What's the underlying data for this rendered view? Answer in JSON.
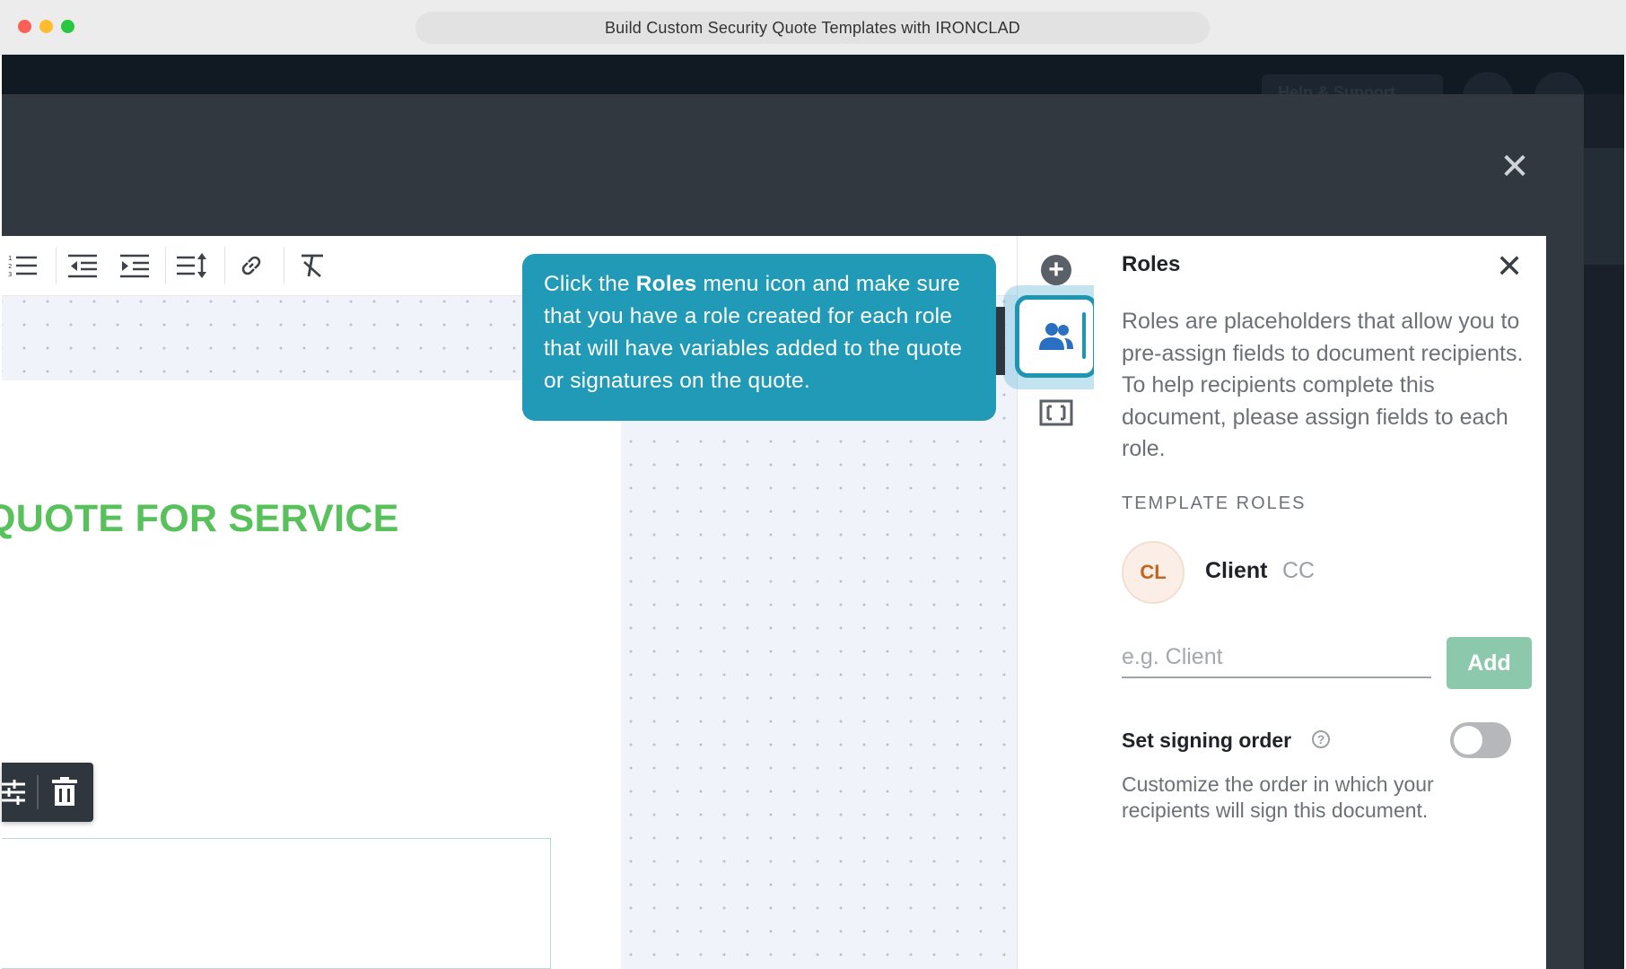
{
  "window": {
    "title": "Build Custom Security Quote Templates with IRONCLAD"
  },
  "app_header": {
    "help_button_label": "Help & Support"
  },
  "modal": {
    "close_icon": "close-icon"
  },
  "toolbar": {
    "icons": [
      "numbered-list-icon",
      "outdent-icon",
      "indent-icon",
      "line-height-icon",
      "link-icon",
      "clear-format-icon"
    ]
  },
  "document": {
    "heading": "QUOTE FOR SERVICE"
  },
  "tooltip": {
    "prefix": "Click the ",
    "bold": "Roles",
    "suffix": " menu icon and make sure that you have a role created for each role that will have variables added to the quote or signatures on the quote."
  },
  "side_icons": [
    "add-icon",
    "roles-icon",
    "frame-icon"
  ],
  "roles_panel": {
    "title": "Roles",
    "description": "Roles are placeholders that allow you to pre-assign fields to document recipients. To help recipients complete this document, please assign fields to each role.",
    "section_label": "TEMPLATE ROLES",
    "roles": [
      {
        "initials": "CL",
        "name": "Client",
        "tag": "CC"
      }
    ],
    "input_placeholder": "e.g. Client",
    "add_label": "Add",
    "signing_order_label": "Set signing order",
    "signing_order_enabled": false,
    "signing_order_desc": "Customize the order in which your recipients will sign this document."
  },
  "colors": {
    "accent": "#219ab8",
    "heading_green": "#58c15c",
    "add_button": "#8cc9ac"
  }
}
